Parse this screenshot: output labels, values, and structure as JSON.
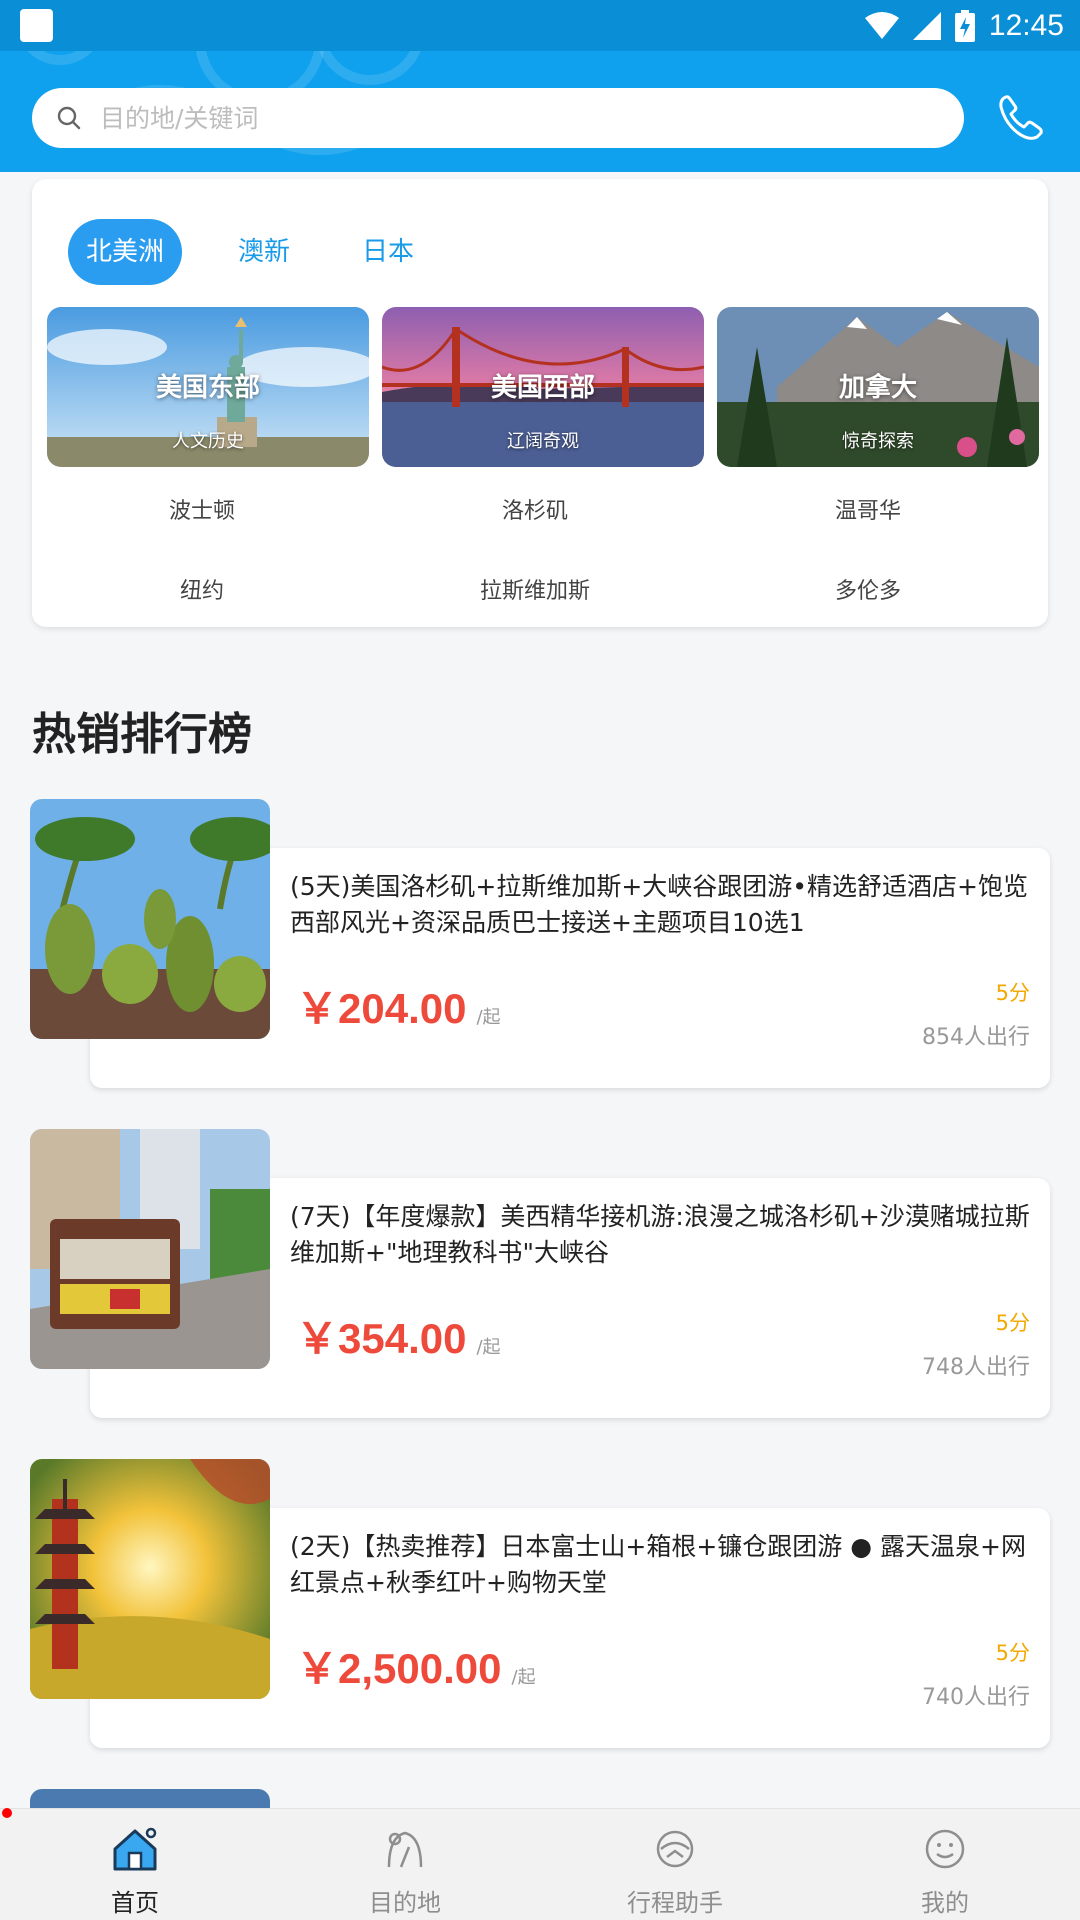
{
  "status_bar": {
    "time": "12:45",
    "icons": [
      "wifi-icon",
      "signal-icon",
      "battery-charging-icon"
    ]
  },
  "header": {
    "search_placeholder": "目的地/关键词",
    "search_icon": "search-icon",
    "phone_icon": "phone-icon",
    "accent_color": "#10a1ee"
  },
  "regions": {
    "tabs": [
      {
        "label": "北美洲",
        "active": true
      },
      {
        "label": "澳新",
        "active": false
      },
      {
        "label": "日本",
        "active": false
      }
    ],
    "cards": [
      {
        "title": "美国东部",
        "subtitle": "人文历史"
      },
      {
        "title": "美国西部",
        "subtitle": "辽阔奇观"
      },
      {
        "title": "加拿大",
        "subtitle": "惊奇探索"
      }
    ],
    "cities": [
      [
        "波士顿",
        "纽约"
      ],
      [
        "洛杉矶",
        "拉斯维加斯"
      ],
      [
        "温哥华",
        "多伦多"
      ]
    ]
  },
  "hot_list": {
    "title": "热销排行榜",
    "items": [
      {
        "name": "(5天)美国洛杉矶+拉斯维加斯+大峡谷跟团游•精选舒适酒店+饱览西部风光+资深品质巴士接送+主题项目10选1",
        "price": "￥204.00",
        "unit": "/起",
        "score": "5分",
        "travelers": "854人出行"
      },
      {
        "name": "(7天)【年度爆款】美西精华接机游:浪漫之城洛杉矶+沙漠赌城拉斯维加斯+\"地理教科书\"大峡谷",
        "price": "￥354.00",
        "unit": "/起",
        "score": "5分",
        "travelers": "748人出行"
      },
      {
        "name": "(2天)【热卖推荐】日本富士山+箱根+镰仓跟团游 ● 露天温泉+网红景点+秋季红叶+购物天堂",
        "price": "￥2,500.00",
        "unit": "/起",
        "score": "5分",
        "travelers": "740人出行"
      }
    ],
    "price_color": "#ee4a3b",
    "score_color": "#f2a900"
  },
  "bottom_nav": [
    {
      "label": "首页",
      "icon": "home-icon",
      "active": true
    },
    {
      "label": "目的地",
      "icon": "destination-icon",
      "active": false
    },
    {
      "label": "行程助手",
      "icon": "assistant-icon",
      "active": false
    },
    {
      "label": "我的",
      "icon": "profile-icon",
      "active": false
    }
  ]
}
